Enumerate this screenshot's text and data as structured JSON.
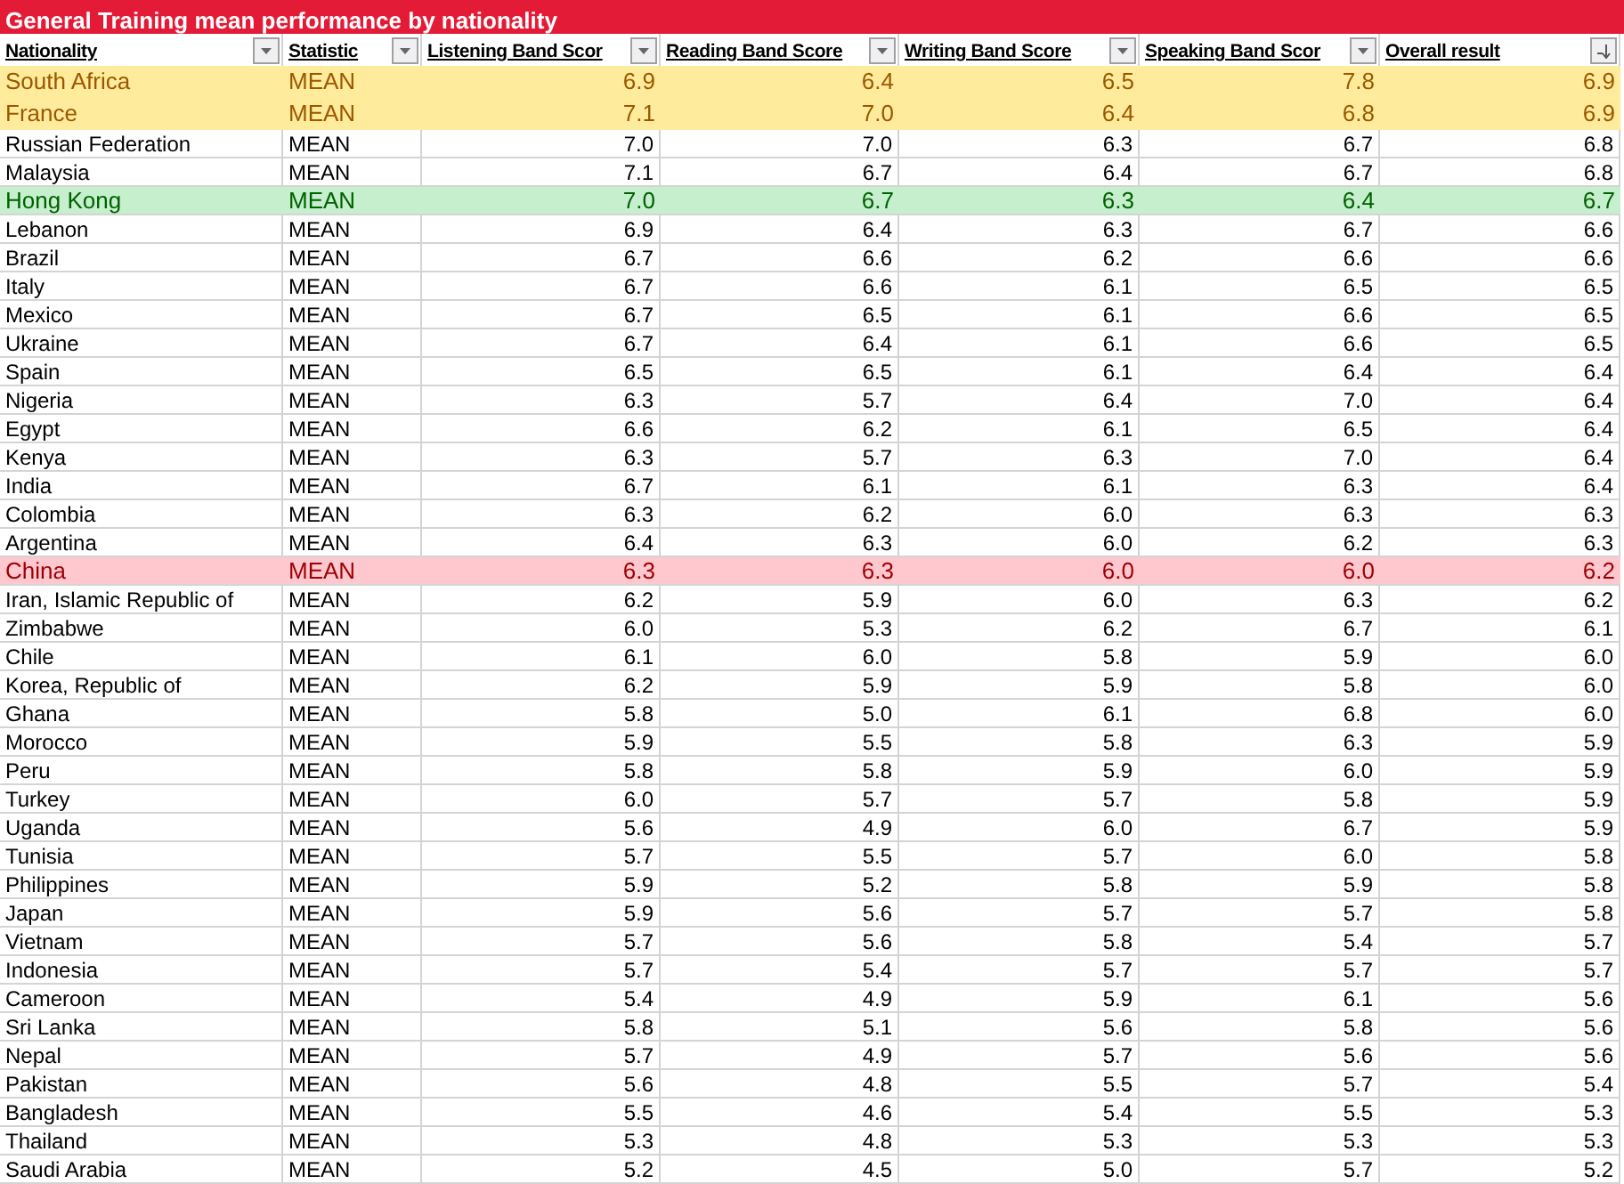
{
  "sheet_title": "General Training mean performance by nationality",
  "columns": [
    {
      "label": "Nationality",
      "sorted": false
    },
    {
      "label": "Statistic",
      "sorted": false
    },
    {
      "label": "Listening Band Scor",
      "sorted": false
    },
    {
      "label": "Reading Band Score",
      "sorted": false
    },
    {
      "label": "Writing Band Score",
      "sorted": false
    },
    {
      "label": "Speaking Band Scor",
      "sorted": false
    },
    {
      "label": "Overall result",
      "sorted": true
    }
  ],
  "rows": [
    {
      "cells": [
        "South Africa",
        "MEAN",
        "6.9",
        "6.4",
        "6.5",
        "7.8",
        "6.9"
      ],
      "color": "#ffeb9c"
    },
    {
      "cells": [
        "France",
        "MEAN",
        "7.1",
        "7.0",
        "6.4",
        "6.8",
        "6.9"
      ],
      "color": "#ffeb9c"
    },
    {
      "cells": [
        "Russian Federation",
        "MEAN",
        "7.0",
        "7.0",
        "6.3",
        "6.7",
        "6.8"
      ]
    },
    {
      "cells": [
        "Malaysia",
        "MEAN",
        "7.1",
        "6.7",
        "6.4",
        "6.7",
        "6.8"
      ]
    },
    {
      "cells": [
        "Hong Kong",
        "MEAN",
        "7.0",
        "6.7",
        "6.3",
        "6.4",
        "6.7"
      ],
      "color": "#c6efce"
    },
    {
      "cells": [
        "Lebanon",
        "MEAN",
        "6.9",
        "6.4",
        "6.3",
        "6.7",
        "6.6"
      ]
    },
    {
      "cells": [
        "Brazil",
        "MEAN",
        "6.7",
        "6.6",
        "6.2",
        "6.6",
        "6.6"
      ]
    },
    {
      "cells": [
        "Italy",
        "MEAN",
        "6.7",
        "6.6",
        "6.1",
        "6.5",
        "6.5"
      ]
    },
    {
      "cells": [
        "Mexico",
        "MEAN",
        "6.7",
        "6.5",
        "6.1",
        "6.6",
        "6.5"
      ]
    },
    {
      "cells": [
        "Ukraine",
        "MEAN",
        "6.7",
        "6.4",
        "6.1",
        "6.6",
        "6.5"
      ]
    },
    {
      "cells": [
        "Spain",
        "MEAN",
        "6.5",
        "6.5",
        "6.1",
        "6.4",
        "6.4"
      ]
    },
    {
      "cells": [
        "Nigeria",
        "MEAN",
        "6.3",
        "5.7",
        "6.4",
        "7.0",
        "6.4"
      ]
    },
    {
      "cells": [
        "Egypt",
        "MEAN",
        "6.6",
        "6.2",
        "6.1",
        "6.5",
        "6.4"
      ]
    },
    {
      "cells": [
        "Kenya",
        "MEAN",
        "6.3",
        "5.7",
        "6.3",
        "7.0",
        "6.4"
      ]
    },
    {
      "cells": [
        "India",
        "MEAN",
        "6.7",
        "6.1",
        "6.1",
        "6.3",
        "6.4"
      ]
    },
    {
      "cells": [
        "Colombia",
        "MEAN",
        "6.3",
        "6.2",
        "6.0",
        "6.3",
        "6.3"
      ]
    },
    {
      "cells": [
        "Argentina",
        "MEAN",
        "6.4",
        "6.3",
        "6.0",
        "6.2",
        "6.3"
      ]
    },
    {
      "cells": [
        "China",
        "MEAN",
        "6.3",
        "6.3",
        "6.0",
        "6.0",
        "6.2"
      ],
      "color": "#ffc7ce"
    },
    {
      "cells": [
        "Iran, Islamic Republic of",
        "MEAN",
        "6.2",
        "5.9",
        "6.0",
        "6.3",
        "6.2"
      ]
    },
    {
      "cells": [
        "Zimbabwe",
        "MEAN",
        "6.0",
        "5.3",
        "6.2",
        "6.7",
        "6.1"
      ]
    },
    {
      "cells": [
        "Chile",
        "MEAN",
        "6.1",
        "6.0",
        "5.8",
        "5.9",
        "6.0"
      ]
    },
    {
      "cells": [
        "Korea, Republic of",
        "MEAN",
        "6.2",
        "5.9",
        "5.9",
        "5.8",
        "6.0"
      ]
    },
    {
      "cells": [
        "Ghana",
        "MEAN",
        "5.8",
        "5.0",
        "6.1",
        "6.8",
        "6.0"
      ]
    },
    {
      "cells": [
        "Morocco",
        "MEAN",
        "5.9",
        "5.5",
        "5.8",
        "6.3",
        "5.9"
      ]
    },
    {
      "cells": [
        "Peru",
        "MEAN",
        "5.8",
        "5.8",
        "5.9",
        "6.0",
        "5.9"
      ]
    },
    {
      "cells": [
        "Turkey",
        "MEAN",
        "6.0",
        "5.7",
        "5.7",
        "5.8",
        "5.9"
      ]
    },
    {
      "cells": [
        "Uganda",
        "MEAN",
        "5.6",
        "4.9",
        "6.0",
        "6.7",
        "5.9"
      ]
    },
    {
      "cells": [
        "Tunisia",
        "MEAN",
        "5.7",
        "5.5",
        "5.7",
        "6.0",
        "5.8"
      ]
    },
    {
      "cells": [
        "Philippines",
        "MEAN",
        "5.9",
        "5.2",
        "5.8",
        "5.9",
        "5.8"
      ]
    },
    {
      "cells": [
        "Japan",
        "MEAN",
        "5.9",
        "5.6",
        "5.7",
        "5.7",
        "5.8"
      ]
    },
    {
      "cells": [
        "Vietnam",
        "MEAN",
        "5.7",
        "5.6",
        "5.8",
        "5.4",
        "5.7"
      ]
    },
    {
      "cells": [
        "Indonesia",
        "MEAN",
        "5.7",
        "5.4",
        "5.7",
        "5.7",
        "5.7"
      ]
    },
    {
      "cells": [
        "Cameroon",
        "MEAN",
        "5.4",
        "4.9",
        "5.9",
        "6.1",
        "5.6"
      ]
    },
    {
      "cells": [
        "Sri Lanka",
        "MEAN",
        "5.8",
        "5.1",
        "5.6",
        "5.8",
        "5.6"
      ]
    },
    {
      "cells": [
        "Nepal",
        "MEAN",
        "5.7",
        "4.9",
        "5.7",
        "5.6",
        "5.6"
      ]
    },
    {
      "cells": [
        "Pakistan",
        "MEAN",
        "5.6",
        "4.8",
        "5.5",
        "5.7",
        "5.4"
      ]
    },
    {
      "cells": [
        "Bangladesh",
        "MEAN",
        "5.5",
        "4.6",
        "5.4",
        "5.5",
        "5.3"
      ]
    },
    {
      "cells": [
        "Thailand",
        "MEAN",
        "5.3",
        "4.8",
        "5.3",
        "5.3",
        "5.3"
      ]
    },
    {
      "cells": [
        "Saudi Arabia",
        "MEAN",
        "5.2",
        "4.5",
        "5.0",
        "5.7",
        "5.2"
      ]
    }
  ]
}
